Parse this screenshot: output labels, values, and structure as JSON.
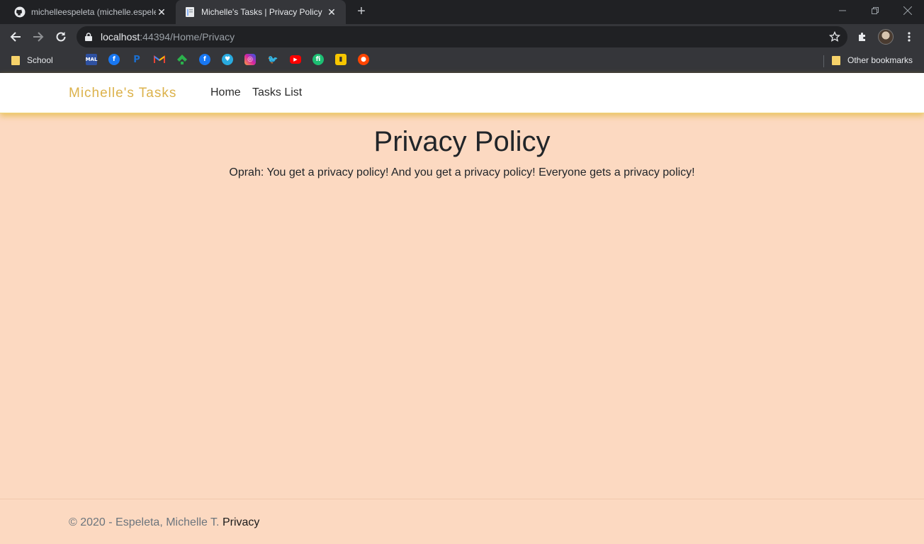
{
  "browser": {
    "tabs": [
      {
        "title": "michelleespeleta (michelle.espeleta)",
        "icon": "github-icon",
        "active": false
      },
      {
        "title": "Michelle's Tasks | Privacy Policy",
        "icon": "page-icon",
        "active": true
      }
    ],
    "address": {
      "host": "localhost",
      "rest": ":44394/Home/Privacy"
    },
    "bookmarks": {
      "first_folder": "School",
      "sites": [
        "myanimelist-icon",
        "facebook-icon",
        "paypal-icon",
        "gmail-icon",
        "feedly-icon",
        "facebook-icon",
        "ko-fi-icon",
        "instagram-icon",
        "twitter-icon",
        "youtube-icon",
        "fiverr-icon",
        "notes-icon",
        "reddit-icon"
      ],
      "other_folder": "Other bookmarks"
    }
  },
  "site": {
    "brand": "Michelle's Tasks",
    "nav": [
      "Home",
      "Tasks List"
    ],
    "brand_color": "#dcb24b",
    "background_color": "#fcd9c1"
  },
  "main": {
    "title": "Privacy Policy",
    "text": "Oprah: You get a privacy policy! And you get a privacy policy! Everyone gets a privacy policy!"
  },
  "footer": {
    "copyright": "© 2020 - Espeleta, Michelle T.",
    "link": "Privacy"
  }
}
